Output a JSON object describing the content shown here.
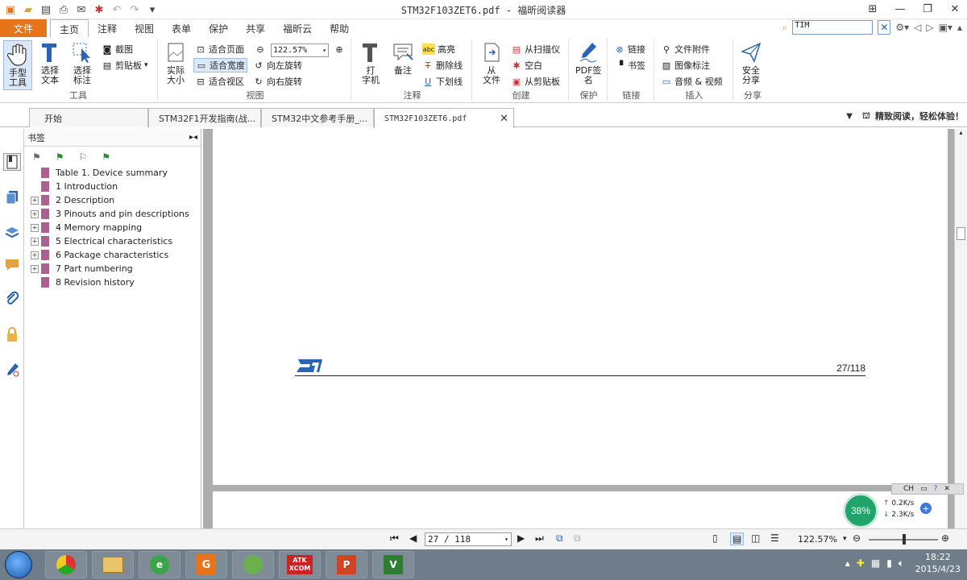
{
  "window": {
    "title": "STM32F103ZET6.pdf - 福昕阅读器"
  },
  "menu": {
    "file": "文件",
    "tabs": [
      "主页",
      "注释",
      "视图",
      "表单",
      "保护",
      "共享",
      "福昕云",
      "帮助"
    ],
    "active_tab": "主页",
    "search_value": "TIM"
  },
  "ribbon": {
    "tools": {
      "label": "工具",
      "hand": "手型\n工具",
      "select_text": "选择\n文本",
      "select_annot": "选择\n标注",
      "screenshot": "截图",
      "clipboard": "剪贴板"
    },
    "view": {
      "label": "视图",
      "actual_size": "实际\n大小",
      "fit_page": "适合页面",
      "fit_width": "适合宽度",
      "fit_visible": "适合视区",
      "zoom_value": "122.57%",
      "rotate_left": "向左旋转",
      "rotate_right": "向右旋转"
    },
    "comment": {
      "label": "注释",
      "typewriter": "打\n字机",
      "note": "备注",
      "highlight": "高亮",
      "strikeout": "删除线",
      "underline": "下划线"
    },
    "create": {
      "label": "创建",
      "from_file": "从\n文件",
      "from_scanner": "从扫描仪",
      "blank": "空白",
      "from_clipboard": "从剪贴板"
    },
    "protect": {
      "label": "保护",
      "pdf_sign": "PDF签\n名"
    },
    "link": {
      "label": "链接",
      "link": "链接",
      "bookmark": "书签"
    },
    "insert": {
      "label": "插入",
      "attachment": "文件附件",
      "image_annot": "图像标注",
      "audio_video": "音频 & 视频"
    },
    "share": {
      "label": "分享",
      "secure_share": "安全\n分享"
    }
  },
  "doc_tabs": [
    {
      "label": "开始"
    },
    {
      "label": "STM32F1开发指南(战..."
    },
    {
      "label": "STM32中文参考手册_..."
    },
    {
      "label": "STM32F103ZET6.pdf"
    }
  ],
  "promo": "精致阅读，轻松体验！",
  "bookmarks": {
    "title": "书签",
    "items": [
      {
        "label": "Table 1. Device summary",
        "expandable": false
      },
      {
        "label": "1 Introduction",
        "expandable": false
      },
      {
        "label": "2 Description",
        "expandable": true
      },
      {
        "label": "3 Pinouts and pin descriptions",
        "expandable": true
      },
      {
        "label": "4 Memory mapping",
        "expandable": true
      },
      {
        "label": "5 Electrical characteristics",
        "expandable": true
      },
      {
        "label": "6 Package characteristics",
        "expandable": true
      },
      {
        "label": "7 Part numbering",
        "expandable": true
      },
      {
        "label": "8 Revision history",
        "expandable": false
      }
    ]
  },
  "page": {
    "number": "27/118"
  },
  "nav": {
    "page_value": "27 / 118",
    "zoom": "122.57%"
  },
  "net": {
    "percent": "38%",
    "up": "0.2K/s",
    "down": "2.3K/s",
    "lang": "CH"
  },
  "taskbar": {
    "apps": [
      "ATK XCOM"
    ],
    "time": "18:22",
    "date": "2015/4/23"
  }
}
